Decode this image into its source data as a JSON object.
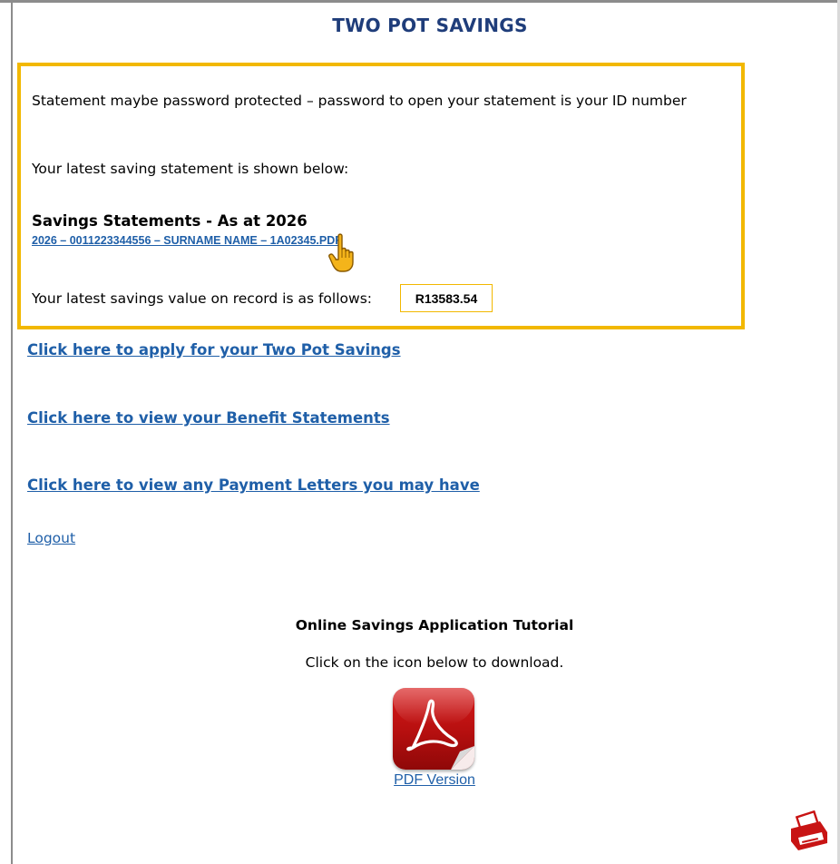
{
  "page": {
    "title": "TWO POT SAVINGS"
  },
  "notice": {
    "password_text": "Statement maybe password protected – password to open your statement is your ID number",
    "latest_text": "Your latest saving statement is shown below:",
    "statements_heading": "Savings Statements - As at 2026",
    "statement_file_link": "2026 – 0011223344556 – SURNAME NAME – 1A02345.PDF",
    "value_label": "Your latest savings value on record is as follows:",
    "value": "R13583.54"
  },
  "links": {
    "apply": "Click here to apply for your Two Pot Savings",
    "benefit": "Click here to view your Benefit Statements",
    "payment": "Click here to view any Payment Letters you may have",
    "logout": "Logout"
  },
  "tutorial": {
    "title": "Online Savings Application Tutorial",
    "subtitle": "Click on the icon below to download.",
    "pdf_link": "PDF Version"
  },
  "icons": {
    "cursor": "hand-pointer-icon",
    "pdf": "pdf-document-icon",
    "print": "printer-icon"
  },
  "colors": {
    "accent_border": "#f2b800",
    "title": "#1f3d7a",
    "link": "#1f5fa8",
    "pdf_red": "#c81414"
  }
}
